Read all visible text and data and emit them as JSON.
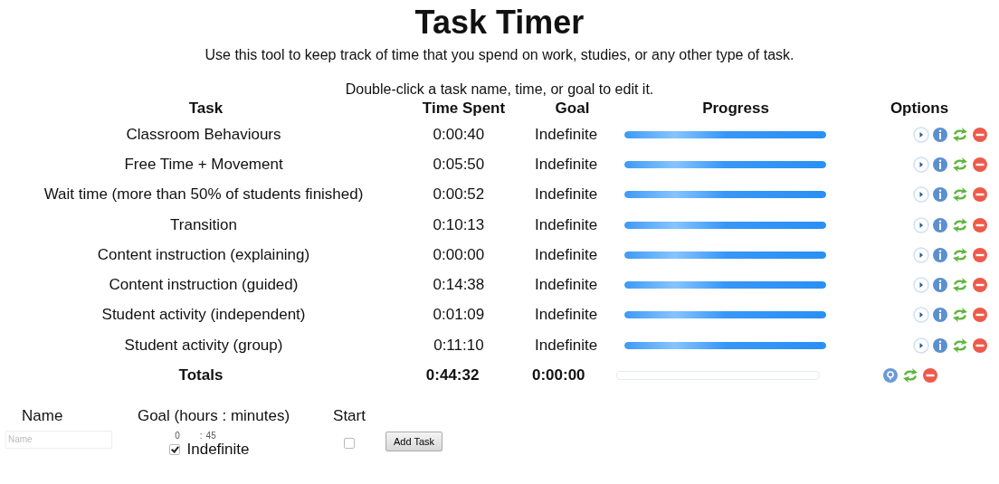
{
  "title": "Task Timer",
  "description": "Use this tool to keep track of time that you spend on work, studies, or any other type of task.",
  "hint": "Double-click a task name, time, or goal to edit it.",
  "columns": [
    "Task",
    "Time Spent",
    "Goal",
    "Progress",
    "Options"
  ],
  "tasks": [
    {
      "name": "Classroom Behaviours",
      "time": "0:00:40",
      "goal": "Indefinite",
      "level": 1
    },
    {
      "name": "Free Time + Movement",
      "time": "0:05:50",
      "goal": "Indefinite",
      "level": 1
    },
    {
      "name": "Wait time (more than 50% of students finished)",
      "time": "0:00:52",
      "goal": "Indefinite",
      "level": 1
    },
    {
      "name": "Transition",
      "time": "0:10:13",
      "goal": "Indefinite",
      "level": 1
    },
    {
      "name": "Content instruction (explaining)",
      "time": "0:00:00",
      "goal": "Indefinite",
      "level": 1
    },
    {
      "name": "Content instruction (guided)",
      "time": "0:14:38",
      "goal": "Indefinite",
      "level": 1
    },
    {
      "name": "Student activity (independent)",
      "time": "0:01:09",
      "goal": "Indefinite",
      "level": 1
    },
    {
      "name": "Student activity (group)",
      "time": "0:11:10",
      "goal": "Indefinite",
      "level": 1
    }
  ],
  "totals": {
    "label": "Totals",
    "time": "0:44:32",
    "goal": "0:00:00",
    "level": 0
  },
  "form": {
    "labels": [
      "Name",
      "Goal (hours : minutes)",
      "Start"
    ],
    "name_placeholder": "Name",
    "hours": "0",
    "minutes": "45",
    "separator": ":",
    "indefinite": {
      "label": "Indefinite",
      "checked": true
    },
    "start_checked": false,
    "button": "Add Task"
  }
}
